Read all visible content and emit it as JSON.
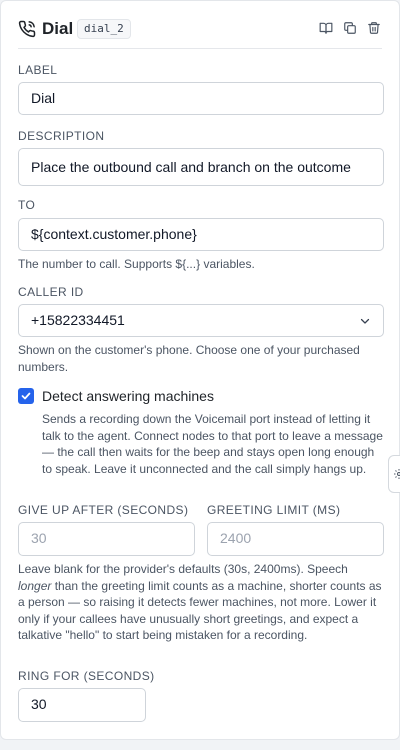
{
  "header": {
    "title": "Dial",
    "node_id": "dial_2",
    "icons": [
      "phone-call-icon",
      "book-icon",
      "copy-icon",
      "trash-icon"
    ]
  },
  "fields": {
    "label": {
      "label": "LABEL",
      "value": "Dial"
    },
    "description": {
      "label": "DESCRIPTION",
      "value": "Place the outbound call and branch on the outcome"
    },
    "to": {
      "label": "TO",
      "value": "${context.customer.phone}",
      "help": "The number to call. Supports ${...} variables."
    },
    "caller_id": {
      "label": "CALLER ID",
      "value": "+15822334451",
      "help": "Shown on the customer's phone. Choose one of your purchased numbers."
    },
    "detect_machines": {
      "checked": true,
      "label": "Detect answering machines",
      "help": "Sends a recording down the Voicemail port instead of letting it talk to the agent. Connect nodes to that port to leave a message — the call then waits for the beep and stays open long enough to speak. Leave it unconnected and the call simply hangs up."
    },
    "give_up_after": {
      "label": "GIVE UP AFTER (SECONDS)",
      "placeholder": "30"
    },
    "greeting_limit": {
      "label": "GREETING LIMIT (MS)",
      "placeholder": "2400"
    },
    "timing_help": {
      "part1": "Leave blank for the provider's defaults (30s, 2400ms). Speech ",
      "emphasis": "longer",
      "part2": " than the greeting limit counts as a machine, shorter counts as a person — so raising it detects fewer machines, not more. Lower it only if your callees have unusually short greetings, and expect a talkative \"hello\" to start being mistaken for a recording."
    },
    "ring_for": {
      "label": "RING FOR (SECONDS)",
      "value": "30"
    }
  },
  "colors": {
    "accent": "#2563eb",
    "border": "#cfd4da",
    "muted_text": "#4b5563"
  }
}
